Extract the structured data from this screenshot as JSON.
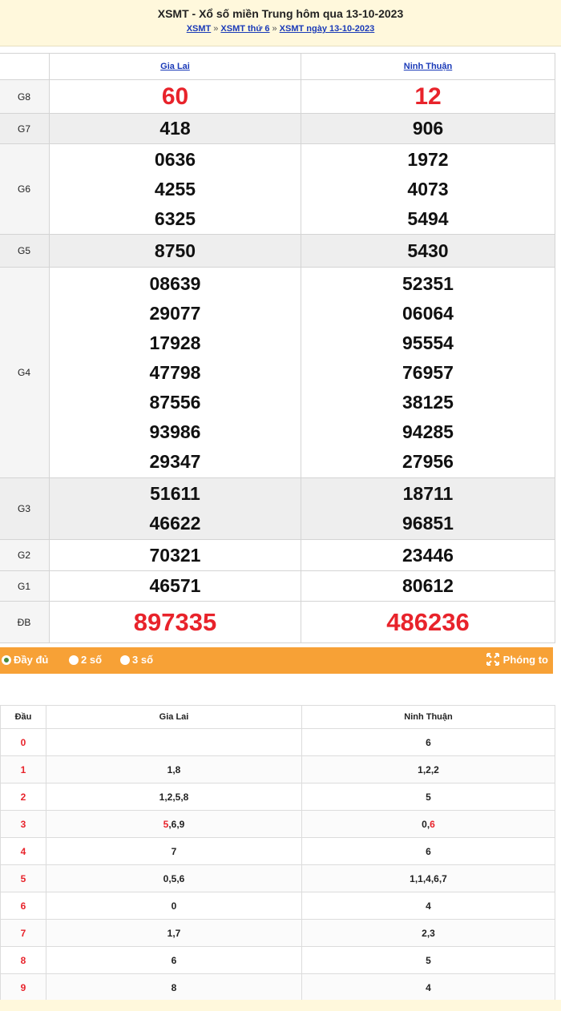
{
  "header": {
    "title": "XSMT - Xổ số miền Trung hôm qua 13-10-2023",
    "crumb1": "XSMT",
    "crumb2": "XSMT thứ 6",
    "crumb3": "XSMT ngày 13-10-2023",
    "sep": "»"
  },
  "results": {
    "provinces": [
      "Gia Lai",
      "Ninh Thuận"
    ],
    "labels": {
      "g8": "G8",
      "g7": "G7",
      "g6": "G6",
      "g5": "G5",
      "g4": "G4",
      "g3": "G3",
      "g2": "G2",
      "g1": "G1",
      "db": "ĐB"
    },
    "gialai": {
      "g8": "60",
      "g7": "418",
      "g6": [
        "0636",
        "4255",
        "6325"
      ],
      "g5": "8750",
      "g4": [
        "08639",
        "29077",
        "17928",
        "47798",
        "87556",
        "93986",
        "29347"
      ],
      "g3": [
        "51611",
        "46622"
      ],
      "g2": "70321",
      "g1": "46571",
      "db": "897335"
    },
    "ninhthuan": {
      "g8": "12",
      "g7": "906",
      "g6": [
        "1972",
        "4073",
        "5494"
      ],
      "g5": "5430",
      "g4": [
        "52351",
        "06064",
        "95554",
        "76957",
        "38125",
        "94285",
        "27956"
      ],
      "g3": [
        "18711",
        "96851"
      ],
      "g2": "23446",
      "g1": "80612",
      "db": "486236"
    }
  },
  "toolbar": {
    "opt_full": "Đầy đủ",
    "opt_2": "2 số",
    "opt_3": "3 số",
    "zoom": "Phóng to",
    "accent": "#f7a136"
  },
  "loto": {
    "head_dau": "Đầu",
    "head_c1": "Gia Lai",
    "head_c2": "Ninh Thuận",
    "rows": [
      {
        "dau": "0",
        "c1": "",
        "c2": "6"
      },
      {
        "dau": "1",
        "c1": "1,8",
        "c2": "1,2,2"
      },
      {
        "dau": "2",
        "c1": "1,2,5,8",
        "c2": "5"
      },
      {
        "dau": "3",
        "c1_hl": "5",
        "c1_rest": ",6,9",
        "c2_pre": "0,",
        "c2_hl": "6"
      },
      {
        "dau": "4",
        "c1": "7",
        "c2": "6"
      },
      {
        "dau": "5",
        "c1": "0,5,6",
        "c2": "1,1,4,6,7"
      },
      {
        "dau": "6",
        "c1": "0",
        "c2": "4"
      },
      {
        "dau": "7",
        "c1": "1,7",
        "c2": "2,3"
      },
      {
        "dau": "8",
        "c1": "6",
        "c2": "5"
      },
      {
        "dau": "9",
        "c1": "8",
        "c2": "4"
      }
    ]
  },
  "colors": {
    "red": "#e8232b",
    "link": "#1a3ab8",
    "header_bg": "#fff8dc"
  }
}
